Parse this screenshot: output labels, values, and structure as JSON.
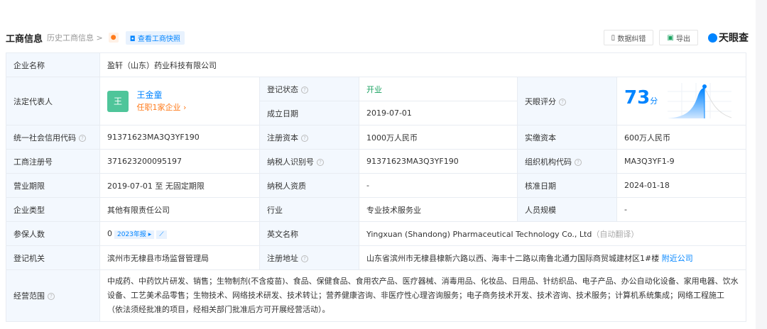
{
  "header": {
    "title": "工商信息",
    "history": "历史工商信息 >",
    "snapshot": "查看工商快照",
    "correct": "数据纠错",
    "export": "导出",
    "logo": "天眼查"
  },
  "rows": {
    "name_label": "企业名称",
    "name": "盈轩（山东）药业科技有限公司",
    "legal_label": "法定代表人",
    "legal_avatar": "王",
    "legal_name": "王金童",
    "legal_jobs": "任职1家企业 ›",
    "status_label": "登记状态",
    "status": "开业",
    "founded_label": "成立日期",
    "founded": "2019-07-01",
    "score_label": "天眼评分",
    "score": "73",
    "score_unit": "分",
    "score_value": 73,
    "credit_label": "统一社会信用代码",
    "credit": "91371623MA3Q3YF190",
    "capital_label": "注册资本",
    "capital": "1000万人民币",
    "paid_label": "实缴资本",
    "paid": "600万人民币",
    "reg_label": "工商注册号",
    "reg": "371623200095197",
    "tax_label": "纳税人识别号",
    "tax": "91371623MA3Q3YF190",
    "org_label": "组织机构代码",
    "org": "MA3Q3YF1-9",
    "term_label": "营业期限",
    "term": "2019-07-01 至 无固定期限",
    "taxq_label": "纳税人资质",
    "taxq": "-",
    "approve_label": "核准日期",
    "approve": "2024-01-18",
    "type_label": "企业类型",
    "type": "其他有限责任公司",
    "industry_label": "行业",
    "industry": "专业技术服务业",
    "staff_label": "人员规模",
    "staff": "-",
    "insured_label": "参保人数",
    "insured": "0",
    "insured_report": "2023年报 ▸",
    "en_label": "英文名称",
    "en": "Yingxuan (Shandong) Pharmaceutical Technology Co., Ltd",
    "en_auto": "（自动翻译）",
    "authority_label": "登记机关",
    "authority": "滨州市无棣县市场监督管理局",
    "addr_label": "注册地址",
    "addr": "山东省滨州市无棣县棣新六路以西、海丰十二路以南鲁北通力国际商贸城建材区1#楼",
    "addr_link": "附近公司",
    "scope_label": "经营范围",
    "scope": "中成药、中药饮片研发、销售；生物制剂(不含疫苗)、食品、保健食品、食用农产品、医疗器械、消毒用品、化妆品、日用品、针纺织品、电子产品、办公自动化设备、家用电器、饮水设备、工艺美术品零售；生物技术、网络技术研发、技术转让；营养健康咨询、非医疗性心理咨询服务；电子商务技术开发、技术咨询、技术服务；计算机系统集成；网络工程施工（依法须经批准的项目，经相关部门批准后方可开展经营活动）。"
  }
}
